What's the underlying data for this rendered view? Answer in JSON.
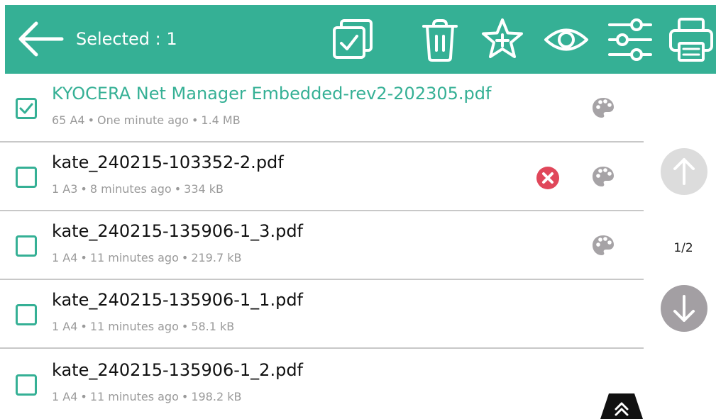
{
  "header": {
    "selected_text": "Selected : 1",
    "tools": [
      {
        "name": "select-all",
        "icon": "select-all-icon"
      },
      {
        "name": "delete",
        "icon": "trash-icon"
      },
      {
        "name": "favorite",
        "icon": "star-plus-icon"
      },
      {
        "name": "preview",
        "icon": "eye-icon"
      },
      {
        "name": "settings",
        "icon": "sliders-icon"
      },
      {
        "name": "print",
        "icon": "printer-icon"
      }
    ],
    "bar_color": "#35b095"
  },
  "files": [
    {
      "name": "KYOCERA Net Manager Embedded-rev2-202305.pdf",
      "pages": "65 A4",
      "time": "One minute ago",
      "size": "1.4 MB",
      "checked": true,
      "error": false,
      "color_icon": "palette-icon"
    },
    {
      "name": "kate_240215-103352-2.pdf",
      "pages": "1 A3",
      "time": "8 minutes ago",
      "size": "334 kB",
      "checked": false,
      "error": true,
      "color_icon": "palette-icon"
    },
    {
      "name": "kate_240215-135906-1_3.pdf",
      "pages": "1 A4",
      "time": "11 minutes ago",
      "size": "219.7 kB",
      "checked": false,
      "error": false,
      "color_icon": "palette-icon"
    },
    {
      "name": "kate_240215-135906-1_1.pdf",
      "pages": "1 A4",
      "time": "11 minutes ago",
      "size": "58.1 kB",
      "checked": false,
      "error": false,
      "color_icon": null
    },
    {
      "name": "kate_240215-135906-1_2.pdf",
      "pages": "1 A4",
      "time": "11 minutes ago",
      "size": "198.2 kB",
      "checked": false,
      "error": false,
      "color_icon": null
    }
  ],
  "pager": {
    "indicator": "1/2",
    "up_enabled": false,
    "down_enabled": true
  },
  "colors": {
    "accent": "#35b095",
    "error": "#e0475a",
    "icon_gray": "#a6a3a6"
  }
}
